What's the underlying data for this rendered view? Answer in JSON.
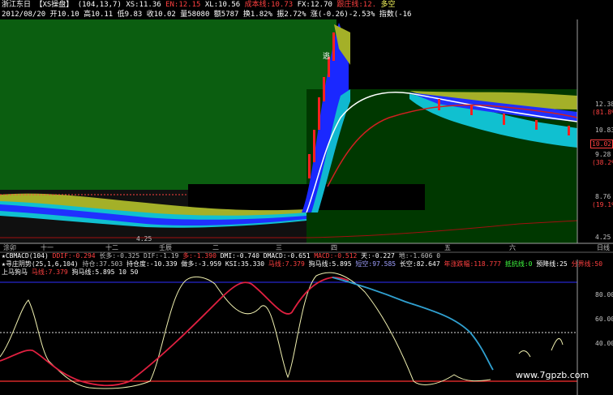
{
  "header": {
    "stock": "浙江东日",
    "tab": "【XS操盘】",
    "params": "(104,13,7)",
    "xs": "XS:11.36",
    "en": "EN:12.15",
    "xl": "XL:10.56",
    "cost": "成本线:10.73",
    "fx": "FX:12.70",
    "zhuang": "跟庄线:12.",
    "duokong": "多空"
  },
  "quote": {
    "date": "2012/08/20",
    "open": "开10.10",
    "high": "高10.11",
    "low": "低9.83",
    "close": "收10.02",
    "volume": "量58080",
    "amount": "额5787",
    "turnover": "换1.82%",
    "amp": "振2.72%",
    "change": "涨(-0.26)-2.53%",
    "index": "指数(-16"
  },
  "price_axis": {
    "labels": [
      "12.38",
      "(81.8%)",
      "10.83",
      "10.02",
      "9.28",
      "(38.2%)",
      "8.76",
      "(19.1%)",
      "4.25"
    ]
  },
  "main_chart": {
    "marker_text": "逃",
    "low_label": "4.25",
    "red_dots": [
      "#ff2020",
      "#ff2020"
    ]
  },
  "time_axis": {
    "labels": [
      "涂卯",
      "十一",
      "十二",
      "壬辰",
      "二",
      "三",
      "四",
      "五",
      "六"
    ],
    "right": "日线"
  },
  "indicator1": {
    "name": "★CBMACD(104)",
    "dif": "DDIF:-0.294",
    "changduo": "长多:-0.325",
    "dif2": "DIF:-1.19",
    "duo": "多:-1.390",
    "dmi": "DMI:-0.740",
    "dmacd": "DMACD:-0.651",
    "macd": "MACD:-0.512",
    "tian": "天:-0.227",
    "di": "地:-1.606",
    "zero": "0"
  },
  "indicator2": {
    "name": "★寻庄阴势(25,1,6,104)",
    "chicang": "持仓:37.503",
    "chicangdu": "持仓度:-10.339",
    "zhuduo": "做多:-3.959",
    "ksi": "KSI:35.330",
    "ma": "马线:7.379",
    "gouma": "狗马线:5.895",
    "duanzhong": "短空:97.585",
    "changkong": "长空:82.647",
    "niandie": "年涨跌幅:118.777",
    "dishi": "抵抗线:0",
    "jiangxian": "预降线:25",
    "fenjie": "分界线:50"
  },
  "indicator3": {
    "name": "上马狗马",
    "ma": "马线:7.379",
    "gouma": "狗马线:5.895",
    "v1": "10",
    "v2": "50"
  },
  "lower_axis": {
    "labels": [
      "80.00",
      "60.00",
      "40.00"
    ]
  },
  "watermark": "www.7gpzb.com",
  "colors": {
    "green_bg": "#0a5a0a",
    "dark_green_bg": "#004000",
    "red": "#ff2020",
    "blue": "#2020ff",
    "cyan": "#00d0e0",
    "yellow_green": "#a0b020",
    "white": "#ffffff"
  }
}
